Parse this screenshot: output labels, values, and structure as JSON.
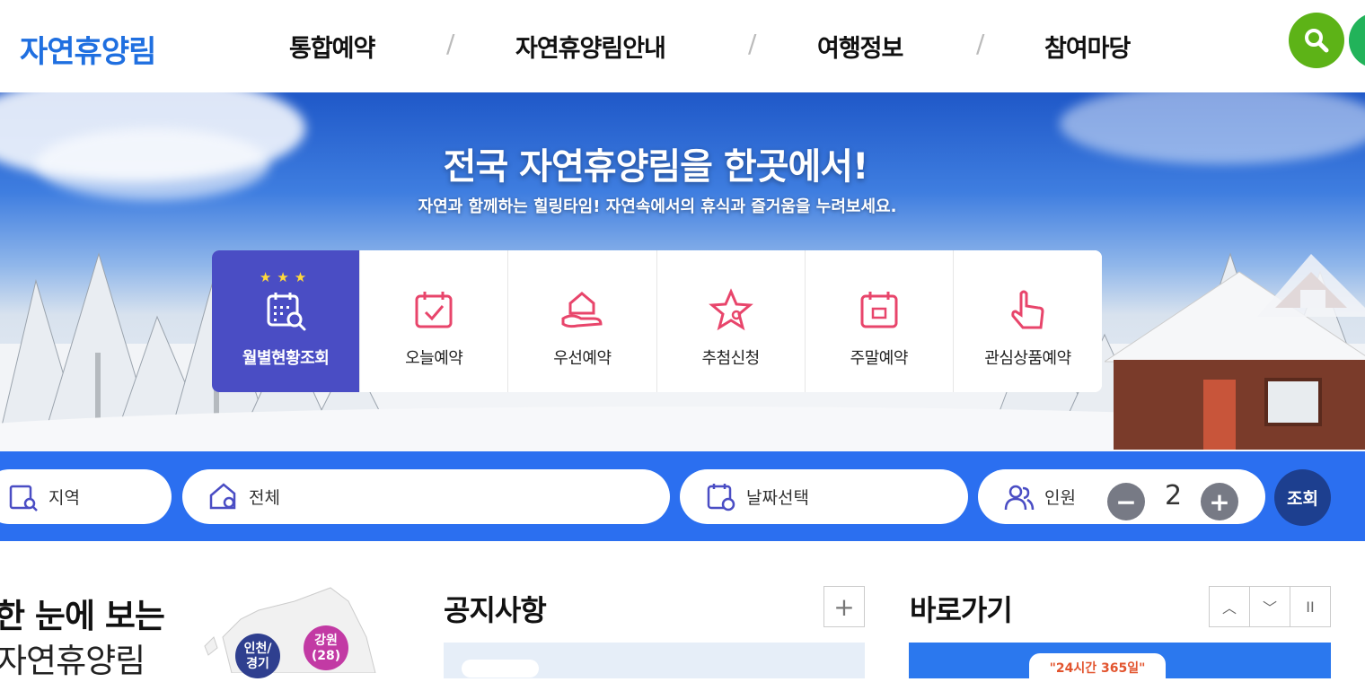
{
  "header": {
    "logo": "자연휴양림",
    "nav": [
      "통합예약",
      "자연휴양림안내",
      "여행정보",
      "참여마당"
    ],
    "separator": "/"
  },
  "hero": {
    "title": "전국 자연휴양림을 한곳에서!",
    "subtitle": "자연과 함께하는 힐링타임! 자연속에서의 휴식과 즐거움을 누려보세요."
  },
  "quick_menu": {
    "stars": "★★★",
    "items": [
      {
        "label": "월별현황조회",
        "icon": "calendar-search-icon",
        "active": true
      },
      {
        "label": "오늘예약",
        "icon": "calendar-check-icon",
        "active": false
      },
      {
        "label": "우선예약",
        "icon": "hand-house-icon",
        "active": false
      },
      {
        "label": "추첨신청",
        "icon": "star-person-icon",
        "active": false
      },
      {
        "label": "주말예약",
        "icon": "calendar-weekend-icon",
        "active": false
      },
      {
        "label": "관심상품예약",
        "icon": "pointer-hand-icon",
        "active": false
      }
    ]
  },
  "search": {
    "region_label": "지역",
    "area_label": "전체",
    "date_label": "날짜선택",
    "people_label": "인원",
    "people_count": "2",
    "minus": "−",
    "plus": "+",
    "submit": "조회"
  },
  "main": {
    "map_title_line1": "한 눈에 보는",
    "map_title_line2": "자연휴양림",
    "regions": [
      {
        "label": "인천/\n경기",
        "color": "#2f3f8f"
      },
      {
        "label": "강원\n(28)",
        "color": "#c23aa4"
      }
    ],
    "notice_title": "공지사항",
    "notice_more": "+",
    "quicklink_title": "바로가기",
    "controls": [
      "︿",
      "﹀",
      "II"
    ],
    "banner_text": "\"24시간 365일\""
  },
  "colors": {
    "brand": "#1f6fe0",
    "active_tab": "#4a4dc4",
    "search_bar": "#2b6ff0",
    "search_green": "#5db317",
    "submit": "#1d3f8f",
    "icon_pink": "#e8456b"
  }
}
